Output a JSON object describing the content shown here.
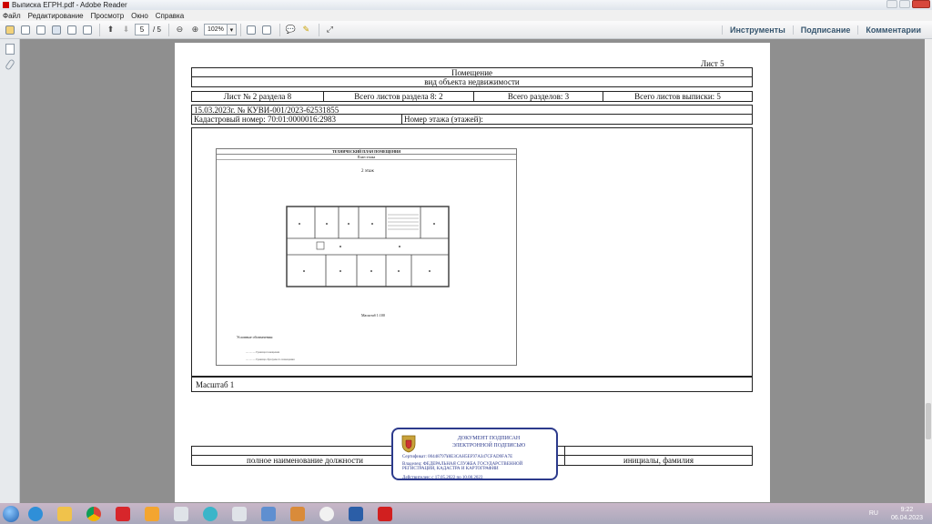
{
  "window": {
    "title": "Выписка ЕГРН.pdf - Adobe Reader"
  },
  "menu": [
    "Файл",
    "Редактирование",
    "Просмотр",
    "Окно",
    "Справка"
  ],
  "toolbar": {
    "page_current": "5",
    "page_total": "/ 5",
    "zoom": "102%",
    "right_links": [
      "Инструменты",
      "Подписание",
      "Комментарии"
    ]
  },
  "document": {
    "sheet_label": "Лист 5",
    "header_line1": "Помещение",
    "header_line2": "вид объекта недвижимости",
    "info_row": [
      "Лист № 2 раздела 8",
      "Всего листов раздела 8: 2",
      "Всего разделов: 3",
      "Всего листов выписки: 5"
    ],
    "date_number": "15.03.2023г. № КУВИ-001/2023-62531855",
    "cadastral": "Кадастровый номер: 70:01:0000016:2983",
    "floor_number": "Номер этажа (этажей):",
    "plan": {
      "title": "ТЕХНИЧЕСКИЙ ПЛАН ПОМЕЩЕНИЯ",
      "subtitle": "План этажа",
      "floor": "2 этаж",
      "scale_small": "Масштаб 1:100",
      "legend_title": "Условные обозначения:",
      "legend_1": "— — — Граница помещения",
      "legend_2": "— — — Граница образуемого помещения"
    },
    "scale": "Масштаб 1",
    "footer_position": "полное наименование должности",
    "footer_initials": "инициалы, фамилия"
  },
  "stamp": {
    "line1": "ДОКУМЕНТ ПОДПИСАН",
    "line2": "ЭЛЕКТРОННОЙ ПОДПИСЬЮ",
    "cert": "Сертификат: 00448797¥8ЕЗСАН5ЕF97АЗ47СFАD9FА7Е",
    "owner": "Владелец: ФЕДЕРАЛЬНАЯ СЛУЖБА ГОСУДАРСТВЕННОЙ РЕГИСТРАЦИИ, КАДАСТРА И КАРТОГРАФИИ",
    "valid": "Действителен: с 17.05.2022 по 10.08.2023"
  },
  "taskbar": {
    "lang": "RU",
    "time": "9:22",
    "date": "06.04.2023"
  }
}
